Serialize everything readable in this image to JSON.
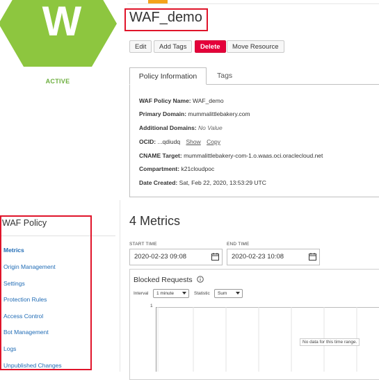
{
  "resource": {
    "logo_letter": "W",
    "status": "ACTIVE",
    "title": "WAF_demo"
  },
  "actions": {
    "edit": "Edit",
    "add_tags": "Add Tags",
    "delete": "Delete",
    "move": "Move Resource"
  },
  "tabs": {
    "policy_information": "Policy Information",
    "tags": "Tags"
  },
  "info": {
    "waf_policy_name_label": "WAF Policy Name:",
    "waf_policy_name": "WAF_demo",
    "primary_domain_label": "Primary Domain:",
    "primary_domain": "mummalittlebakery.com",
    "additional_domains_label": "Additional Domains:",
    "additional_domains": "No Value",
    "ocid_label": "OCID:",
    "ocid": "...qdiudq",
    "show": "Show",
    "copy": "Copy",
    "cname_label": "CNAME Target:",
    "cname": "mummalittlebakery-com-1.o.waas.oci.oraclecloud.net",
    "compartment_label": "Compartment:",
    "compartment": "k21cloudpoc",
    "date_created_label": "Date Created:",
    "date_created": "Sat, Feb 22, 2020, 13:53:29 UTC"
  },
  "sidebar": {
    "title": "WAF Policy",
    "items": [
      {
        "label": "Metrics"
      },
      {
        "label": "Origin Management"
      },
      {
        "label": "Settings"
      },
      {
        "label": "Protection Rules"
      },
      {
        "label": "Access Control"
      },
      {
        "label": "Bot Management"
      },
      {
        "label": "Logs"
      },
      {
        "label": "Unpublished Changes"
      }
    ]
  },
  "metrics": {
    "title": "4 Metrics",
    "start_label": "START TIME",
    "start_value": "2020-02-23 09:08",
    "end_label": "END TIME",
    "end_value": "2020-02-23 10:08",
    "chart_title": "Blocked Requests",
    "interval_label": "Interval",
    "interval_value": "1 minute",
    "statistic_label": "Statistic",
    "statistic_value": "Sum",
    "y_tick": "1",
    "no_data": "No data for this time range."
  },
  "colors": {
    "logo_green": "#8dc63f",
    "status_green": "#6cae3e",
    "delete_red": "#e4003a",
    "link_blue": "#1f6bb5",
    "highlight_red": "#e0142a",
    "accent_orange": "#f4a31b"
  }
}
